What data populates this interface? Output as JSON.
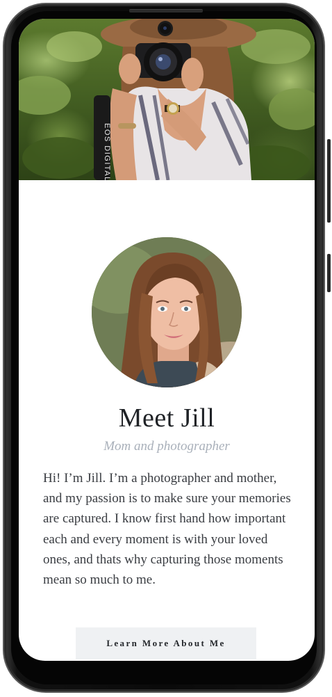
{
  "profile": {
    "name_heading": "Meet Jill",
    "tagline": "Mom and photographer",
    "bio": "Hi! I’m Jill. I’m a photographer and mother, and my passion is to make sure your memories are captured. I know first hand how important each and every moment is with your loved ones, and thats why capturing those moments mean so much to me.",
    "cta_label": "Learn More About Me"
  },
  "hero": {
    "strap_text": "EOS DIGITAL"
  },
  "colors": {
    "heading": "#1f2226",
    "tagline": "#a9b0ba",
    "body_text": "#3a3d42",
    "button_bg": "#eff1f3"
  }
}
